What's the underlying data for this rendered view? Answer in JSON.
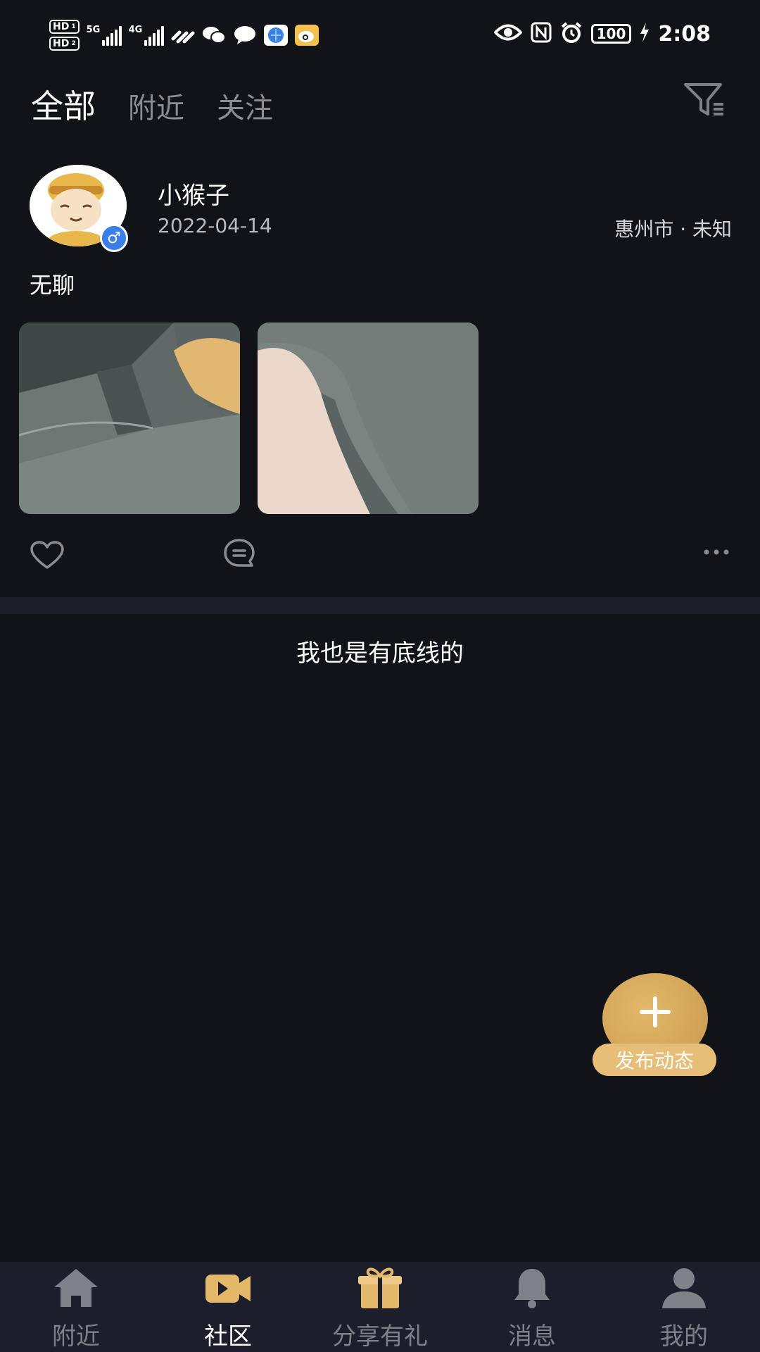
{
  "status_bar": {
    "sim1": "HD",
    "sim1_index": "1",
    "sim2": "HD",
    "sim2_index": "2",
    "net1": "5G",
    "net2": "4G",
    "battery": "100",
    "time": "2:08",
    "icons": [
      "wifi-link-icon",
      "wechat-icon",
      "message-icon",
      "browser-icon",
      "weibo-icon",
      "eye-icon",
      "nfc-icon",
      "alarm-icon",
      "charging-icon"
    ]
  },
  "tabs": [
    {
      "label": "全部",
      "active": true
    },
    {
      "label": "附近",
      "active": false
    },
    {
      "label": "关注",
      "active": false
    }
  ],
  "post": {
    "username": "小猴子",
    "date": "2022-04-14",
    "location": "惠州市 · 未知",
    "gender_symbol": "♂",
    "text": "无聊",
    "image_count": 2
  },
  "feed_end_text": "我也是有底线的",
  "fab": {
    "label": "发布动态"
  },
  "bottom_nav": [
    {
      "label": "附近",
      "icon": "home-icon",
      "active": false
    },
    {
      "label": "社区",
      "icon": "video-camera-icon",
      "active": true
    },
    {
      "label": "分享有礼",
      "icon": "gift-icon",
      "active": false
    },
    {
      "label": "消息",
      "icon": "bell-icon",
      "active": false
    },
    {
      "label": "我的",
      "icon": "user-icon",
      "active": false
    }
  ],
  "colors": {
    "background": "#121318",
    "nav_background": "#1d1e2c",
    "accent_gold": "#e3b86b",
    "inactive_text": "#8c8d93",
    "badge_blue": "#3a7ee8"
  }
}
